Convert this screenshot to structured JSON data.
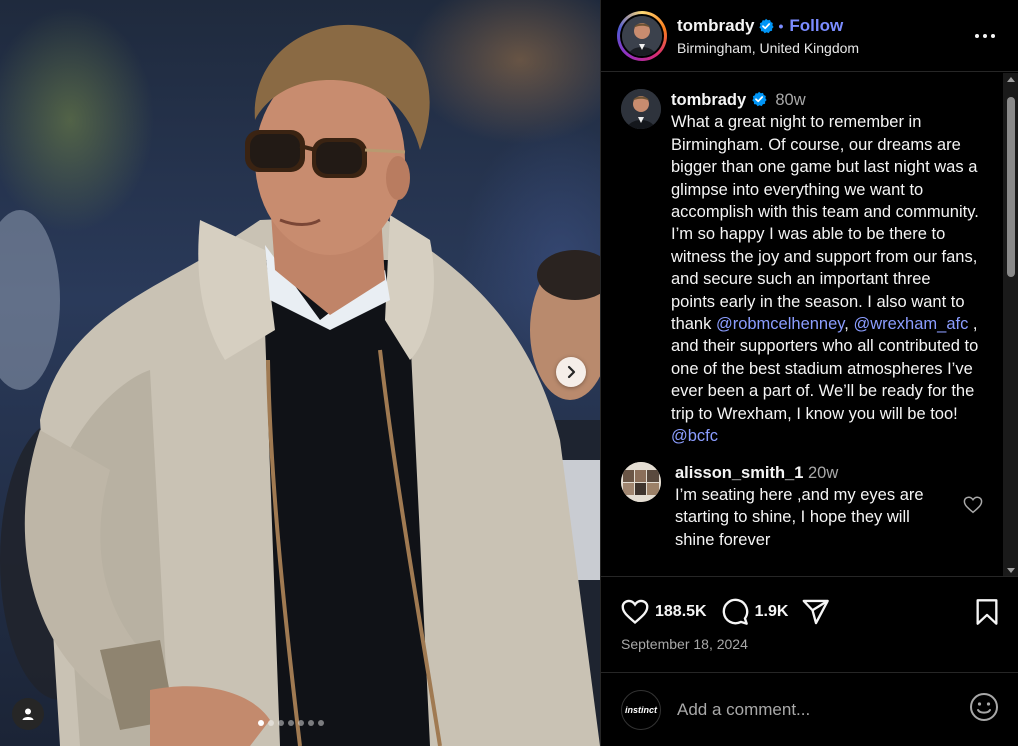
{
  "header": {
    "username": "tombrady",
    "follow_label": "Follow",
    "separator": "•",
    "location": "Birmingham, United Kingdom"
  },
  "caption": {
    "username": "tombrady",
    "time": "80w",
    "text_part1": "What a great night to remember in Birmingham. Of course, our dreams are bigger than one game but last night was a glimpse into everything we want to accomplish with this team and community. I’m so happy I was able to be there to witness the joy and support from our fans, and secure such an important three points early in the season. I also want to thank ",
    "mention1": "@robmcelhenney",
    "comma": ", ",
    "mention2": "@wrexham_afc",
    "text_part2": " , and their supporters who all contributed to one of the best stadium atmospheres I’ve ever been a part of. We’ll be ready for the trip to Wrexham, I know you will be too! ",
    "mention3": "@bcfc"
  },
  "comment": {
    "username": "alisson_smith_1",
    "time": "20w",
    "text": "I’m seating here ,and my eyes are starting to shine, I hope they will shine forever"
  },
  "actions": {
    "likes": "188.5K",
    "comments": "1.9K"
  },
  "post_date": "September 18, 2024",
  "add_comment": {
    "placeholder": "Add a comment...",
    "avatar_text": "instinct"
  },
  "carousel": {
    "total": 7,
    "current": 1
  },
  "colors": {
    "link": "#8b9dff",
    "follow": "#7b8cff",
    "verified": "#0095f6",
    "muted": "#a8a8a8"
  },
  "icons": [
    "chevron-right-icon",
    "user-tag-icon",
    "verified-icon",
    "more-icon",
    "heart-icon",
    "comment-icon",
    "share-icon",
    "bookmark-icon",
    "emoji-icon"
  ]
}
